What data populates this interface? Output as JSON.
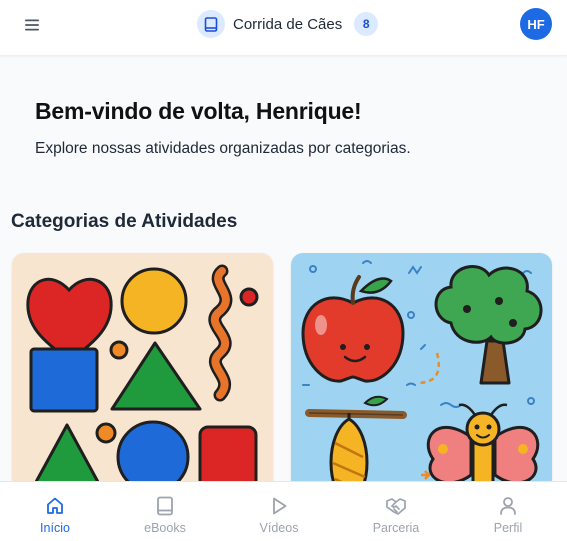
{
  "header": {
    "menu_icon": "hamburger-menu-icon",
    "book_icon": "book-icon",
    "title": "Corrida de Cães",
    "badge_count": "8",
    "avatar_initials": "HF"
  },
  "welcome": {
    "title": "Bem-vindo de volta, Henrique!",
    "subtitle": "Explore nossas atividades organizadas por categorias."
  },
  "categories": {
    "title": "Categorias de Atividades",
    "cards": [
      {
        "illustration": "colorful-shapes"
      },
      {
        "illustration": "apple-tree-caterpillar-butterfly"
      }
    ]
  },
  "bottom_nav": {
    "items": [
      {
        "label": "Início",
        "icon": "home-icon",
        "active": true
      },
      {
        "label": "eBooks",
        "icon": "book-icon",
        "active": false
      },
      {
        "label": "Vídeos",
        "icon": "play-icon",
        "active": false
      },
      {
        "label": "Parceria",
        "icon": "handshake-icon",
        "active": false
      },
      {
        "label": "Perfil",
        "icon": "user-icon",
        "active": false
      }
    ]
  },
  "colors": {
    "accent": "#1d6ae5",
    "inactive": "#9ca3af",
    "badge_bg": "#dbeafe"
  }
}
